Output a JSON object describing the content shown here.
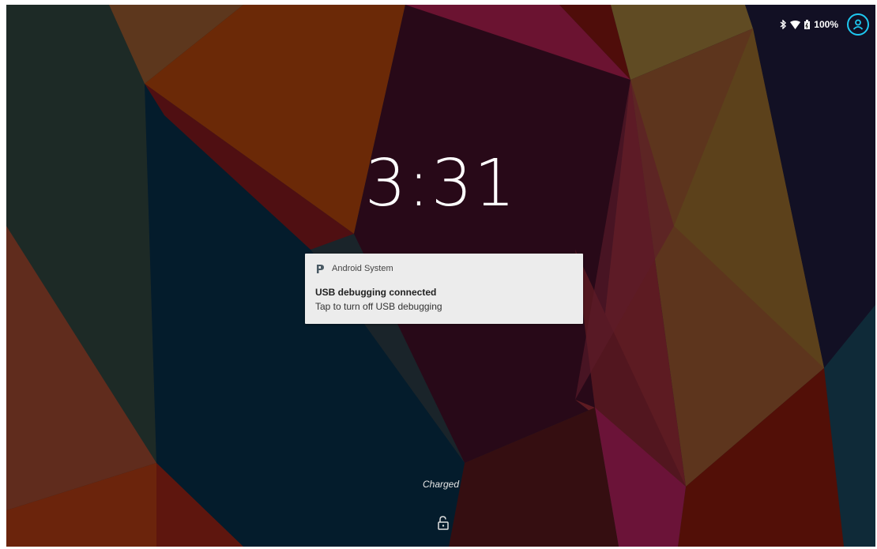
{
  "status_bar": {
    "battery_percent": "100%",
    "icons": [
      "bluetooth-icon",
      "wifi-icon",
      "battery-icon",
      "account-icon"
    ],
    "accent_color": "#1ec8f0"
  },
  "clock": {
    "time": "3:31"
  },
  "notification": {
    "app_name": "Android System",
    "title": "USB debugging connected",
    "text": "Tap to turn off USB debugging"
  },
  "lockscreen": {
    "status_text": "Charged",
    "lock_icon": "lock-open-icon"
  }
}
